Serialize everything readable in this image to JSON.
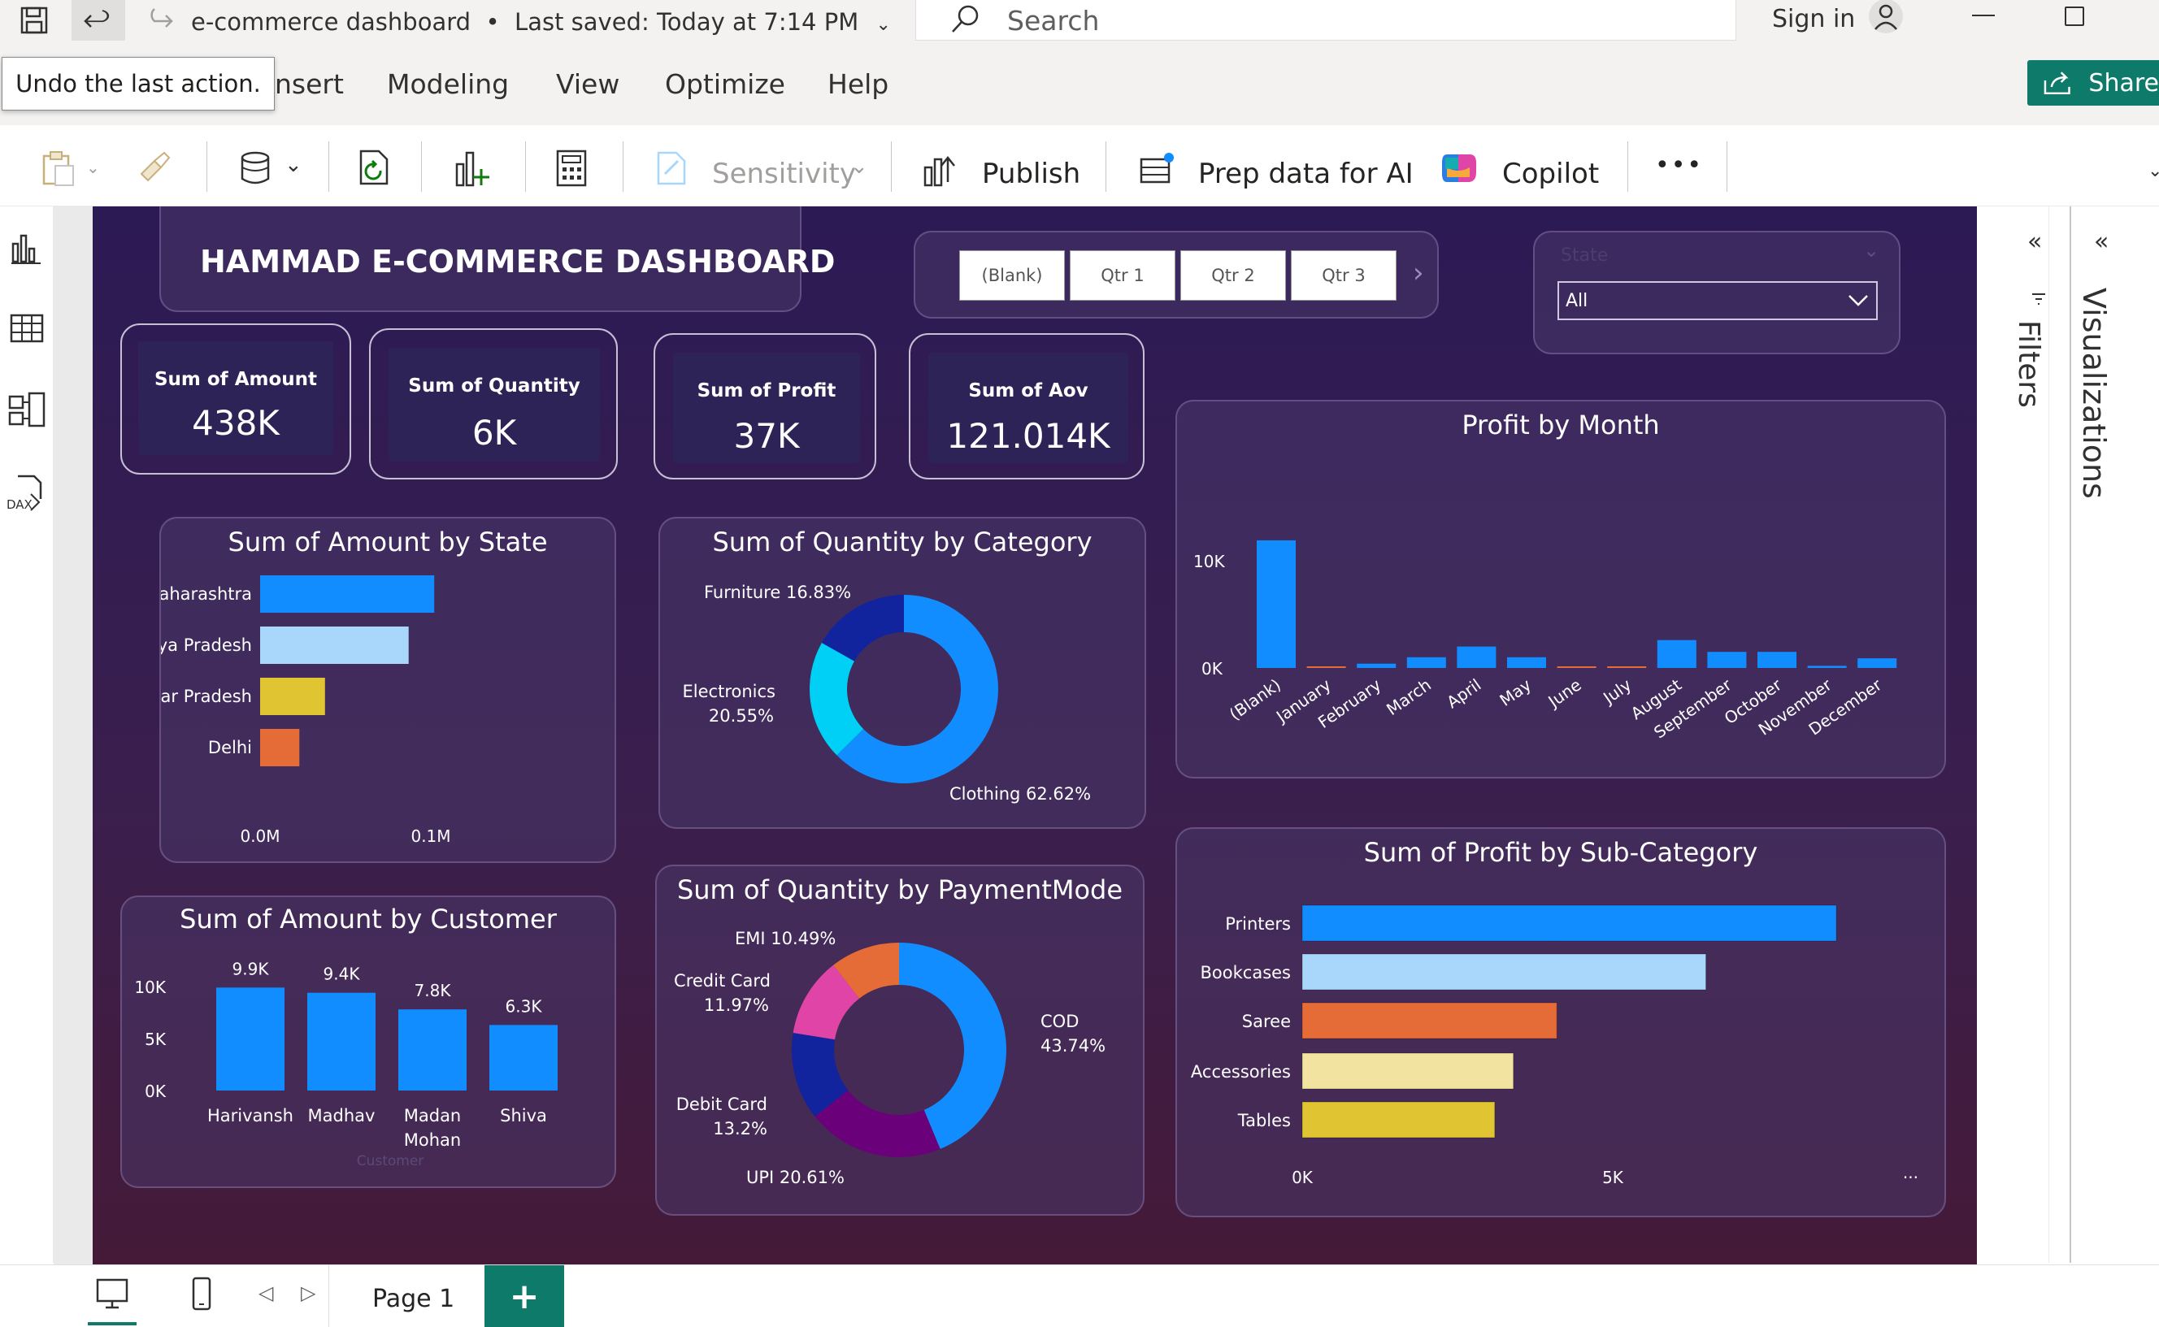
{
  "titlebar": {
    "doc_title": "e-commerce dashboard",
    "saved_status": "Last saved: Today at 7:14 PM",
    "search_placeholder": "Search",
    "signin_label": "Sign in"
  },
  "tooltip": {
    "text": "Undo the last action."
  },
  "menu": {
    "items": [
      "nsert",
      "Modeling",
      "View",
      "Optimize",
      "Help"
    ],
    "share_label": "Share"
  },
  "toolbar": {
    "sensitivity_label": "Sensitivity",
    "publish_label": "Publish",
    "prep_label": "Prep data for AI",
    "copilot_label": "Copilot",
    "more_label": "•••"
  },
  "panes": {
    "filters_label": "Filters",
    "visualizations_label": "Visualizations"
  },
  "bottom": {
    "page_tab": "Page 1",
    "add_label": "+"
  },
  "dashboard": {
    "title": "HAMMAD E-COMMERCE DASHBOARD",
    "quarter_slicer": [
      "(Blank)",
      "Qtr 1",
      "Qtr 2",
      "Qtr 3"
    ],
    "state_slicer": {
      "label": "State",
      "value": "All"
    },
    "kpis": [
      {
        "title": "Sum of Amount",
        "value": "438K"
      },
      {
        "title": "Sum of Quantity",
        "value": "6K"
      },
      {
        "title": "Sum of Profit",
        "value": "37K"
      },
      {
        "title": "Sum of Aov",
        "value": "121.014K"
      }
    ]
  },
  "colors": {
    "blue": "#118dff",
    "lightblue": "#a9d7fb",
    "gold": "#e0c431",
    "orange": "#e66c37",
    "cyan": "#00d0f5",
    "navy": "#12239e",
    "pink": "#e044a7",
    "purple": "#6b007b",
    "paleyellow": "#f2e4a0"
  },
  "chart_data": [
    {
      "id": "amount-by-state",
      "type": "bar",
      "orientation": "horizontal",
      "title": "Sum of Amount by State",
      "categories": [
        "Maharashtra",
        "Madhya Pradesh",
        "Uttar Pradesh",
        "Delhi"
      ],
      "values": [
        0.102,
        0.087,
        0.038,
        0.023
      ],
      "colors": [
        "#118dff",
        "#a9d7fb",
        "#e0c431",
        "#e66c37"
      ],
      "xlim": [
        0,
        0.1
      ],
      "ticks": [
        "0.0M",
        "0.1M"
      ]
    },
    {
      "id": "quantity-by-category",
      "type": "pie",
      "donut": true,
      "title": "Sum of Quantity by Category",
      "labels": [
        "Clothing 62.62%",
        "Electronics 20.55%",
        "Furniture 16.83%"
      ],
      "values": [
        62.62,
        20.55,
        16.83
      ],
      "colors": [
        "#118dff",
        "#00d0f5",
        "#12239e"
      ]
    },
    {
      "id": "profit-by-month",
      "type": "bar",
      "title": "Profit by Month",
      "categories": [
        "(Blank)",
        "January",
        "February",
        "March",
        "April",
        "May",
        "June",
        "July",
        "August",
        "September",
        "October",
        "November",
        "December"
      ],
      "values": [
        11900,
        100,
        400,
        1000,
        2000,
        1000,
        100,
        100,
        2600,
        1500,
        1500,
        200,
        900
      ],
      "ylim": [
        0,
        10000
      ],
      "ticks": [
        "0K",
        "10K"
      ]
    },
    {
      "id": "amount-by-customer",
      "type": "bar",
      "title": "Sum of Amount by Customer",
      "xlabel": "Customer",
      "categories": [
        "Harivansh",
        "Madhav",
        "Madan Mohan",
        "Shiva"
      ],
      "values": [
        9900,
        9400,
        7800,
        6300
      ],
      "data_labels": [
        "9.9K",
        "9.4K",
        "7.8K",
        "6.3K"
      ],
      "ylim": [
        0,
        10000
      ],
      "ticks": [
        "0K",
        "5K",
        "10K"
      ]
    },
    {
      "id": "quantity-by-paymentmode",
      "type": "pie",
      "donut": true,
      "title": "Sum of Quantity by PaymentMode",
      "labels": [
        "COD 43.74%",
        "UPI 20.61%",
        "Debit Card 13.2%",
        "Credit Card 11.97%",
        "EMI 10.49%"
      ],
      "values": [
        43.74,
        20.61,
        13.2,
        11.97,
        10.49
      ],
      "colors": [
        "#118dff",
        "#6b007b",
        "#12239e",
        "#e044a7",
        "#e66c37"
      ]
    },
    {
      "id": "profit-by-subcategory",
      "type": "bar",
      "orientation": "horizontal",
      "title": "Sum of Profit by Sub-Category",
      "categories": [
        "Printers",
        "Bookcases",
        "Saree",
        "Accessories",
        "Tables"
      ],
      "values": [
        8600,
        6500,
        4100,
        3400,
        3100
      ],
      "colors": [
        "#118dff",
        "#a9d7fb",
        "#e66c37",
        "#f2e4a0",
        "#e0c431"
      ],
      "xlim": [
        0,
        5000
      ],
      "ticks": [
        "0K",
        "5K"
      ],
      "more_label": "..."
    }
  ]
}
